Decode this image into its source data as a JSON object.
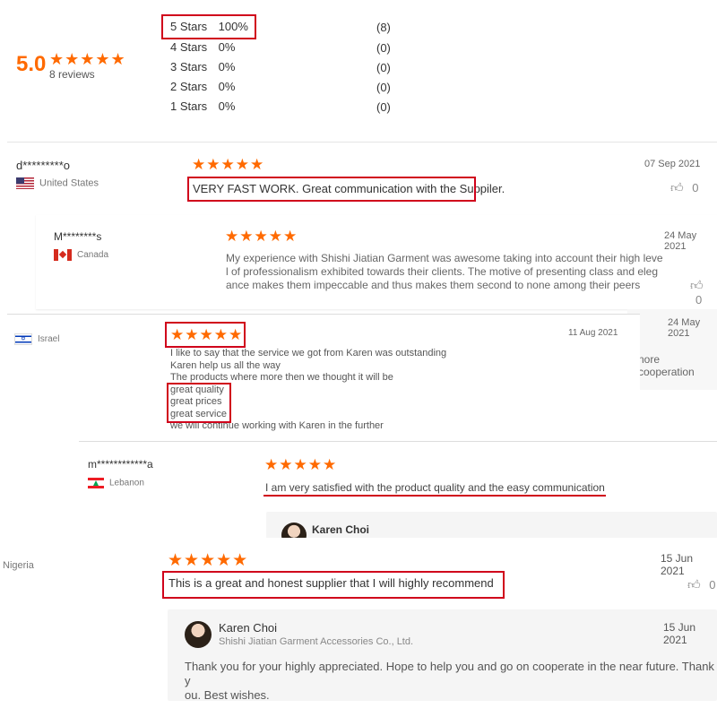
{
  "summary": {
    "score": "5.0",
    "stars": "★★★★★",
    "reviews": "8 reviews",
    "distribution": [
      {
        "label": "5 Stars",
        "pct": "100%",
        "count": "(8)"
      },
      {
        "label": "4 Stars",
        "pct": "0%",
        "count": "(0)"
      },
      {
        "label": "3 Stars",
        "pct": "0%",
        "count": "(0)"
      },
      {
        "label": "2 Stars",
        "pct": "0%",
        "count": "(0)"
      },
      {
        "label": "1 Stars",
        "pct": "0%",
        "count": "(0)"
      }
    ]
  },
  "reviews": [
    {
      "user": "d*********o",
      "country": "United States",
      "stars": "★★★★★",
      "date": "07 Sep 2021",
      "text": "VERY FAST WORK. Great communication with the Suppiler.",
      "likes": "0"
    },
    {
      "user": "M********s",
      "country": "Canada",
      "stars": "★★★★★",
      "date": "24 May 2021",
      "lines": [
        "My experience with Shishi Jiatian Garment was awesome taking into account their high leve",
        "l of professionalism exhibited towards their clients. The motive of presenting class and eleg",
        "ance makes them impeccable and thus makes them second to none among their peers"
      ],
      "likes": "0"
    },
    {
      "date_behind": "24 May 2021",
      "text_behind": "nore cooperation"
    },
    {
      "country": "Israel",
      "stars": "★★★★★",
      "date": "11 Aug 2021",
      "lines": [
        "I like to say that the service we got from Karen was outstanding",
        "Karen help us all the way",
        "The products where more then we thought it will be",
        "great quality",
        "great prices",
        "great service",
        "we will continue working with Karen in the further"
      ]
    },
    {
      "user": "m************a",
      "country": "Lebanon",
      "stars": "★★★★★",
      "text": "I am very satisfied with the product quality and the easy communication",
      "reply_name": "Karen Choi"
    },
    {
      "country": "Nigeria",
      "stars": "★★★★★",
      "date": "15 Jun 2021",
      "text": "This is a great and honest supplier that I will highly recommend",
      "likes": "0",
      "reply": {
        "name": "Karen Choi",
        "company": "Shishi Jiatian Garment Accessories Co., Ltd.",
        "date": "15 Jun 2021",
        "lines": [
          "Thank you for your highly appreciated. Hope to help you and go on cooperate in the near future. Thank y",
          "ou. Best wishes."
        ]
      }
    }
  ],
  "colors": {
    "star": "#ff6a00",
    "highlight": "#d0021b"
  },
  "icons": [
    "star-icon",
    "thumb-up-icon",
    "flag-us-icon",
    "flag-ca-icon",
    "flag-il-icon",
    "flag-lb-icon"
  ]
}
